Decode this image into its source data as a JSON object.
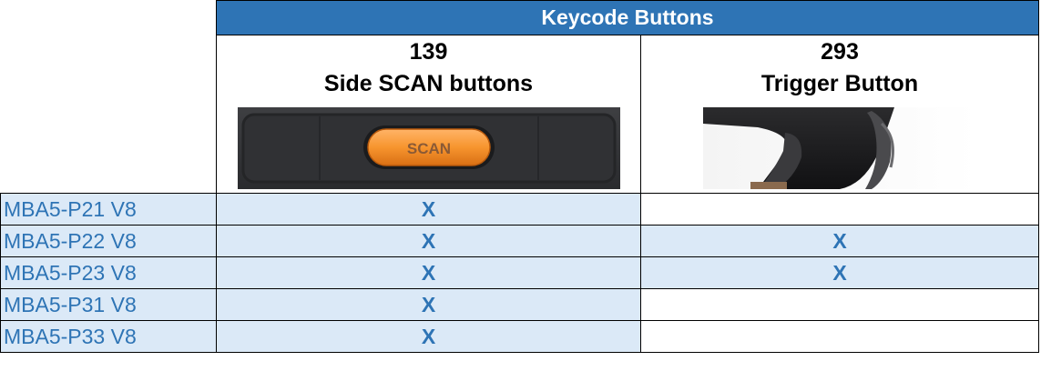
{
  "table": {
    "header": "Keycode Buttons",
    "columns": [
      {
        "code": "139",
        "name": "Side SCAN buttons",
        "image_icon": "scan-button-photo",
        "image_text": "SCAN"
      },
      {
        "code": "293",
        "name": "Trigger Button",
        "image_icon": "trigger-button-photo"
      }
    ],
    "rows": [
      {
        "model": "MBA5-P21 V8",
        "side_scan": "X",
        "trigger": ""
      },
      {
        "model": "MBA5-P22 V8",
        "side_scan": "X",
        "trigger": "X"
      },
      {
        "model": "MBA5-P23 V8",
        "side_scan": "X",
        "trigger": "X"
      },
      {
        "model": "MBA5-P31 V8",
        "side_scan": "X",
        "trigger": ""
      },
      {
        "model": "MBA5-P33 V8",
        "side_scan": "X",
        "trigger": ""
      }
    ]
  },
  "colors": {
    "header_bg": "#2e74b5",
    "accent_text": "#2e74b5",
    "shaded_cell": "#dbe9f7"
  }
}
